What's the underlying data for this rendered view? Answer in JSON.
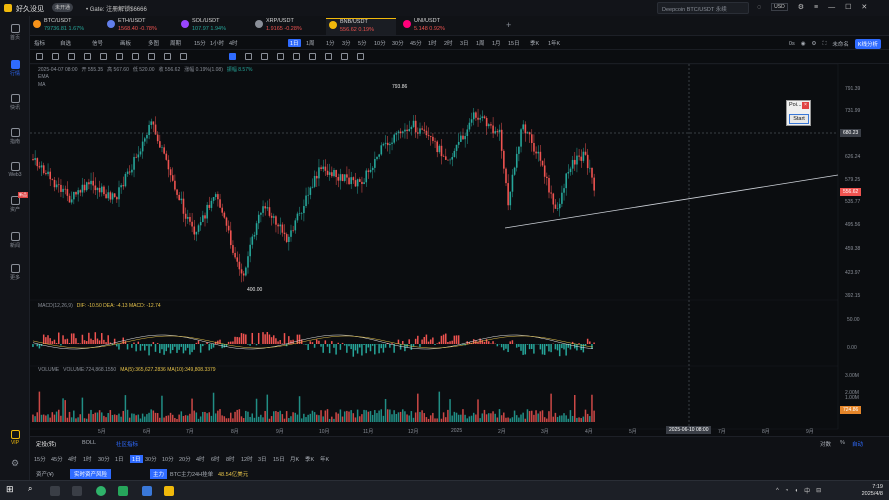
{
  "app": {
    "name": "好久没见",
    "badge": "未开通",
    "announcement": "• Gate: 注册解锁$6666",
    "search_placeholder": "Deepcoin BTC/USDT 永续",
    "currency": "USD"
  },
  "colors": {
    "up": "#26a69a",
    "down": "#ef5350",
    "accent": "#2f6bff",
    "brand": "#f0b90b"
  },
  "sidebar": {
    "items": [
      {
        "label": "首页",
        "icon": "home-icon"
      },
      {
        "label": "行情",
        "icon": "chart-icon"
      },
      {
        "label": "快讯",
        "icon": "news-icon"
      },
      {
        "label": "指南",
        "icon": "guide-icon"
      },
      {
        "label": "Web3",
        "icon": "web3-icon"
      },
      {
        "label": "资产",
        "icon": "wallet-icon"
      },
      {
        "label": "新闻",
        "icon": "newspaper-icon"
      },
      {
        "label": "更多",
        "icon": "more-icon"
      },
      {
        "label": "VIP",
        "icon": "vip-crown-icon"
      }
    ],
    "new_badge": "新品"
  },
  "tickers": [
    {
      "symbol": "BTC/USDT",
      "price": "79736.81",
      "change": "1.67%",
      "color": "#f7931a"
    },
    {
      "symbol": "ETH/USDT",
      "price": "1568.40",
      "change": "-0.78%",
      "color": "#627eea"
    },
    {
      "symbol": "SOL/USDT",
      "price": "107.97",
      "change": "1.94%",
      "color": "#9945ff"
    },
    {
      "symbol": "XRP/USDT",
      "price": "1.9165",
      "change": "-0.28%",
      "color": "#8a8f98"
    },
    {
      "symbol": "BNB/USDT",
      "price": "556.62",
      "change": "0.19%",
      "color": "#f0b90b"
    },
    {
      "symbol": "UNI/USDT",
      "price": "5.148",
      "change": "0.92%",
      "color": "#ff007a"
    }
  ],
  "toolbar": {
    "items": [
      "指标",
      "自选",
      "信号",
      "画板",
      "多图",
      "周期"
    ],
    "periods": [
      "15分",
      "1小时",
      "4时",
      "1日",
      "1周",
      "30分",
      "1分",
      "3分",
      "5分",
      "10分",
      "30分",
      "45分",
      "1时",
      "2时",
      "3日",
      "1周",
      "1月",
      "15日",
      "1年",
      "季K",
      "1年K"
    ],
    "selected_period": "1日",
    "right_items": [
      "0s",
      "未命名",
      "K线分析"
    ]
  },
  "chart": {
    "info": {
      "date": "2025-04-07 08:00",
      "open": "开 555.35",
      "high": "高 567.60",
      "low": "低 520.00",
      "close": "收 556.62",
      "change": "涨幅 0.19%(1.08)",
      "amplitude": "振幅 8.57%"
    },
    "legend_lines": [
      "EMA",
      "MA"
    ],
    "price_axis": [
      "791.39",
      "731.99",
      "680.23",
      "626.24",
      "579.25",
      "535.77",
      "495.56",
      "459.38",
      "423.97",
      "392.15"
    ],
    "current_price": "556.62",
    "crosshair_price": "680.23",
    "high_label": "793.86",
    "low_label": "400.00",
    "time_axis": [
      "5月",
      "6月",
      "7月",
      "8月",
      "9月",
      "10月",
      "11月",
      "12月",
      "2025",
      "2月",
      "3月",
      "4月",
      "5月",
      "7月",
      "8月",
      "9月"
    ],
    "crosshair_time": "2025-06-10 08:00",
    "macd_label": "MACD(12,26,9)",
    "macd_values": "DIF: -10.50  DEA: -4.13  MACD: -12.74",
    "macd_axis": [
      "50.00",
      "0.00"
    ],
    "volume_label": "VOLUME",
    "volume_values": "VOLUME:724,868.1550",
    "volume_ma": "MA(5):365,627.2836  MA(10):349,808.3379",
    "volume_axis": [
      "3.00M",
      "2.00M",
      "1.00M"
    ],
    "volume_current": "724.86"
  },
  "popup": {
    "title": "Poi...",
    "button": "Start"
  },
  "bottom": {
    "tabs": [
      "定投(转)",
      "BOLL",
      "社区指标"
    ],
    "periods": [
      "15分",
      "45分",
      "4时",
      "1时",
      "30分",
      "1日",
      "1时",
      "30分",
      "10分",
      "20分",
      "4时",
      "6时",
      "8时",
      "12时",
      "3日",
      "15日",
      "月K",
      "季K",
      "年K"
    ],
    "selected_period": "1日",
    "right_items": [
      "对数",
      "%",
      "自动"
    ],
    "asset_row": [
      "资产(¥)",
      "实时资产风险",
      "主力",
      "BTC主力24H挂单",
      "48.54亿美元"
    ]
  },
  "taskbar": {
    "time": "7:19",
    "date": "2025/4/8"
  }
}
